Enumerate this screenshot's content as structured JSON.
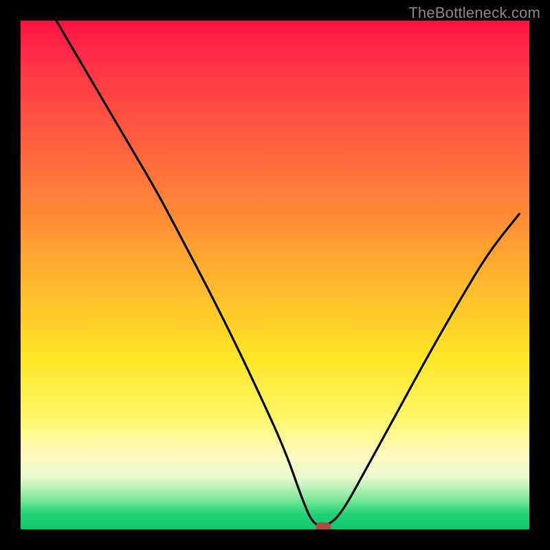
{
  "watermark": {
    "text": "TheBottleneck.com"
  },
  "chart_data": {
    "type": "line",
    "title": "",
    "xlabel": "",
    "ylabel": "",
    "xlim": [
      0,
      1
    ],
    "ylim": [
      0,
      1
    ],
    "series": [
      {
        "name": "bottleneck-curve",
        "x": [
          0.07,
          0.12,
          0.17,
          0.22,
          0.27,
          0.32,
          0.37,
          0.42,
          0.47,
          0.52,
          0.555,
          0.575,
          0.6,
          0.63,
          0.68,
          0.74,
          0.8,
          0.86,
          0.92,
          0.98
        ],
        "values": [
          1.0,
          0.915,
          0.83,
          0.745,
          0.66,
          0.565,
          0.47,
          0.37,
          0.265,
          0.155,
          0.055,
          0.01,
          0.005,
          0.03,
          0.12,
          0.23,
          0.34,
          0.445,
          0.545,
          0.62
        ]
      }
    ],
    "marker": {
      "name": "min-point",
      "x": 0.595,
      "y": 0.005
    },
    "background_gradient": {
      "top": "#ff1144",
      "bottom": "#13c86e"
    }
  }
}
